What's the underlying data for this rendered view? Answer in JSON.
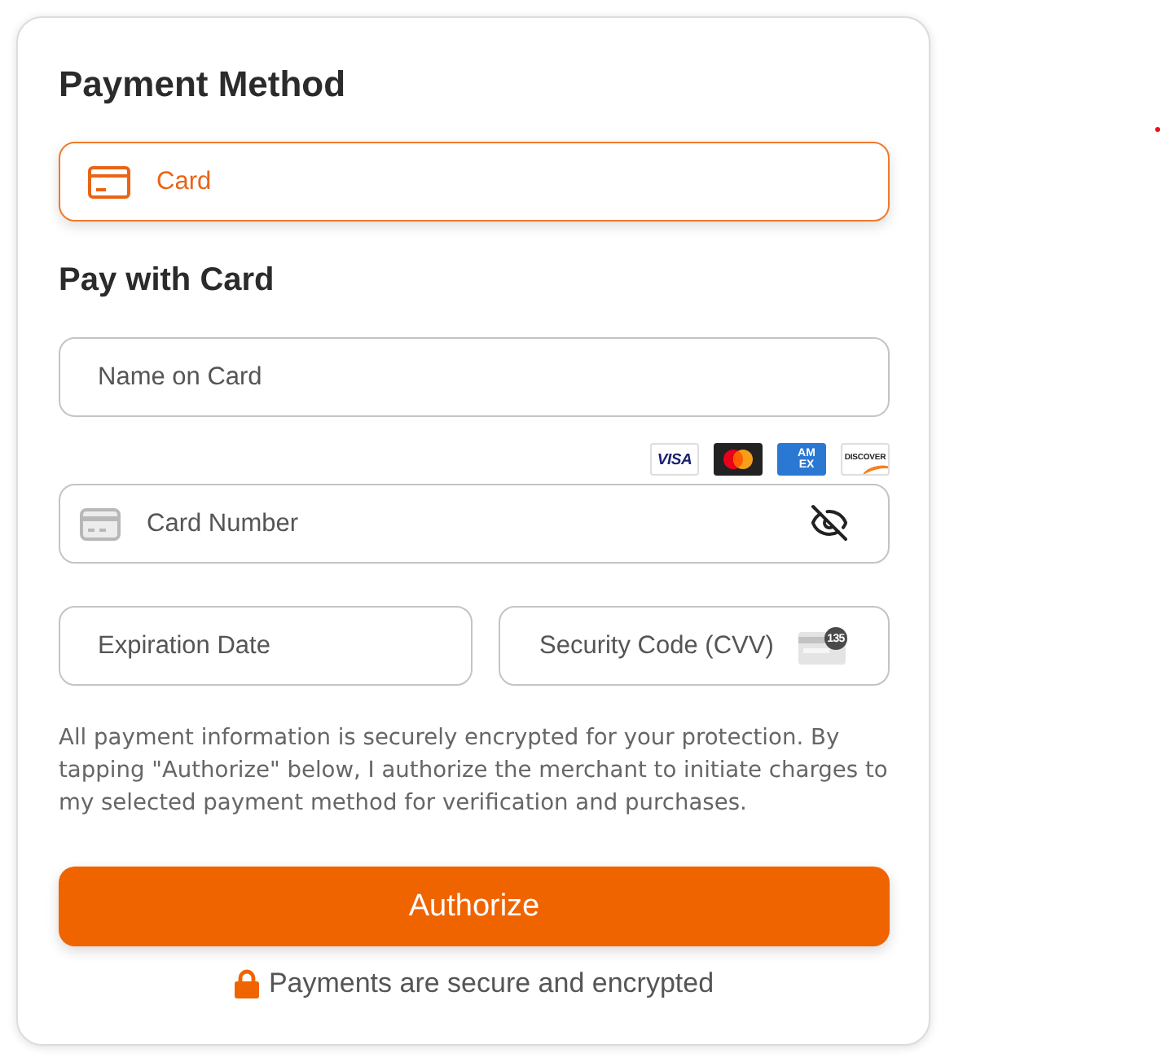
{
  "title": "Payment Method",
  "payment_methods": [
    {
      "label": "Card",
      "selected": true
    }
  ],
  "section_title": "Pay with Card",
  "name_field": {
    "placeholder": "Name on Card"
  },
  "card_brands": [
    {
      "kind": "visa",
      "label": "VISA"
    },
    {
      "kind": "mastercard"
    },
    {
      "kind": "amex",
      "label": "AM EX"
    },
    {
      "kind": "discover",
      "label": "DISCOVER"
    }
  ],
  "card_number_field": {
    "placeholder": "Card Number"
  },
  "expiration_field": {
    "placeholder": "Expiration Date"
  },
  "cvv_field": {
    "placeholder": "Security Code (CVV)",
    "badge": "135"
  },
  "disclaimer": "All payment information is securely encrypted for your protection. By tapping \"Authorize\" below, I authorize the merchant to initiate charges to my selected payment method for verification and purchases.",
  "authorize_button": "Authorize",
  "secure_note": "Payments are secure and encrypted"
}
